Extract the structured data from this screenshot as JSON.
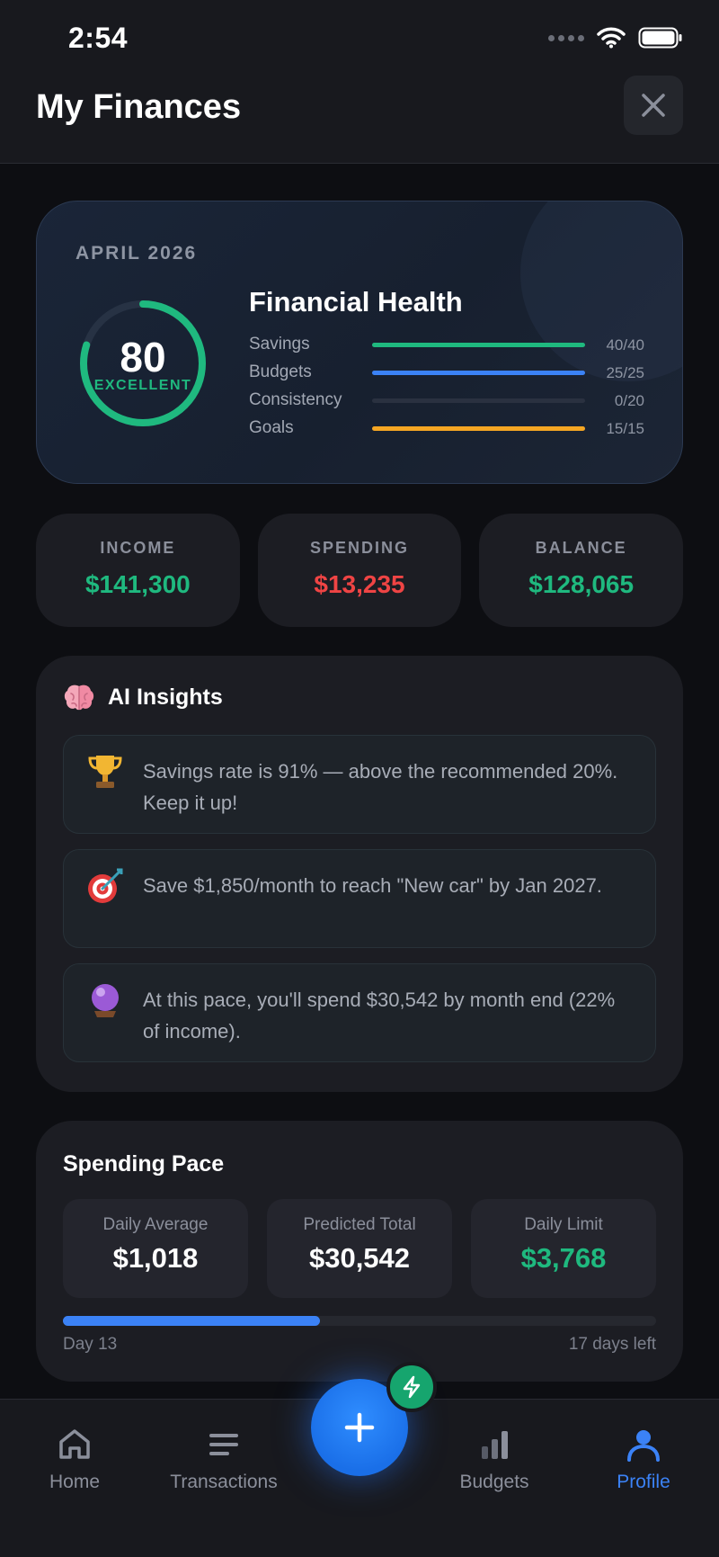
{
  "status_bar": {
    "time": "2:54"
  },
  "header": {
    "title": "My Finances"
  },
  "health": {
    "month": "APRIL 2026",
    "score": "80",
    "score_fraction": 0.8,
    "grade": "EXCELLENT",
    "title": "Financial Health",
    "metrics": [
      {
        "label": "Savings",
        "value": "40/40",
        "fraction": 1.0,
        "color": "#1fb97f"
      },
      {
        "label": "Budgets",
        "value": "25/25",
        "fraction": 1.0,
        "color": "#3b82f6"
      },
      {
        "label": "Consistency",
        "value": "0/20",
        "fraction": 0.0,
        "color": "#3b82f6"
      },
      {
        "label": "Goals",
        "value": "15/15",
        "fraction": 1.0,
        "color": "#f5a623"
      }
    ]
  },
  "summary": [
    {
      "label": "INCOME",
      "value": "$141,300",
      "color": "#1fb97f"
    },
    {
      "label": "SPENDING",
      "value": "$13,235",
      "color": "#ef4444"
    },
    {
      "label": "BALANCE",
      "value": "$128,065",
      "color": "#1fb97f"
    }
  ],
  "insights": {
    "title": "AI Insights",
    "icon": "brain-icon",
    "items": [
      {
        "icon": "trophy-icon",
        "text": "Savings rate is 91% — above the recommended 20%. Keep it up!"
      },
      {
        "icon": "target-icon",
        "text": "Save $1,850/month to reach \"New car\" by Jan 2027."
      },
      {
        "icon": "crystal-ball-icon",
        "text": "At this pace, you'll spend $30,542 by month end (22% of income)."
      }
    ]
  },
  "pace": {
    "title": "Spending Pace",
    "stats": [
      {
        "label": "Daily Average",
        "value": "$1,018",
        "color": "#ffffff"
      },
      {
        "label": "Predicted Total",
        "value": "$30,542",
        "color": "#ffffff"
      },
      {
        "label": "Daily Limit",
        "value": "$3,768",
        "color": "#1fb97f"
      }
    ],
    "progress_fraction": 0.433,
    "day_label": "Day 13",
    "days_left_label": "17 days left"
  },
  "nav": {
    "items": [
      {
        "label": "Home",
        "icon": "home-icon",
        "active": false
      },
      {
        "label": "Transactions",
        "icon": "list-icon",
        "active": false
      },
      {
        "label": "Budgets",
        "icon": "bar-chart-icon",
        "active": false
      },
      {
        "label": "Profile",
        "icon": "profile-icon",
        "active": true
      }
    ],
    "fab_icon": "plus-icon",
    "badge_icon": "lightning-icon",
    "accent": "#3b82f6"
  }
}
